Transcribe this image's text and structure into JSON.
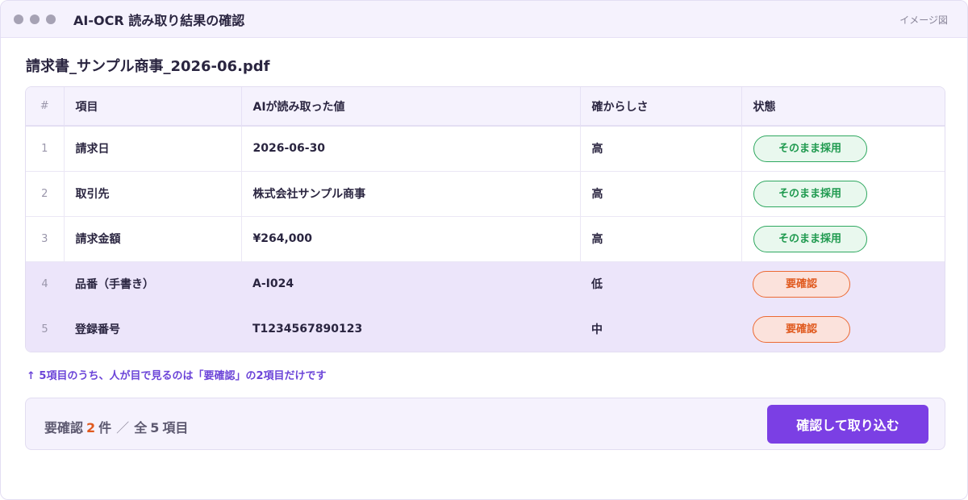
{
  "window": {
    "title": "AI-OCR 読み取り結果の確認",
    "image_label": "イメージ図"
  },
  "file_name": "請求書_サンプル商事_2026-06.pdf",
  "table": {
    "headers": {
      "num": "#",
      "item": "項目",
      "value": "AIが読み取った値",
      "confidence": "確からしさ",
      "status": "状態"
    },
    "rows": [
      {
        "num": "1",
        "item": "請求日",
        "value": "2026-06-30",
        "confidence": "高",
        "status": "そのまま採用"
      },
      {
        "num": "2",
        "item": "取引先",
        "value": "株式会社サンプル商事",
        "confidence": "高",
        "status": "そのまま採用"
      },
      {
        "num": "3",
        "item": "請求金額",
        "value": "¥264,000",
        "confidence": "高",
        "status": "そのまま採用"
      },
      {
        "num": "4",
        "item": "品番（手書き）",
        "value": "A-I024",
        "confidence": "低",
        "status": "要確認"
      },
      {
        "num": "5",
        "item": "登録番号",
        "value": "T1234567890123",
        "confidence": "中",
        "status": "要確認"
      }
    ]
  },
  "note": "↑ 5項目のうち、人が目で見るのは「要確認」の2項目だけです",
  "footer": {
    "summary_prefix": "要確認",
    "count": "2",
    "count_unit": "件",
    "separator": "／",
    "total_prefix": "全",
    "total": "5",
    "total_unit": "項目",
    "import_button": "確認して取り込む"
  },
  "colors": {
    "accent": "#7b3fe4",
    "ok": "#1f9a4f",
    "warn": "#e05a1f",
    "highlight_row": "#ece5fa"
  }
}
